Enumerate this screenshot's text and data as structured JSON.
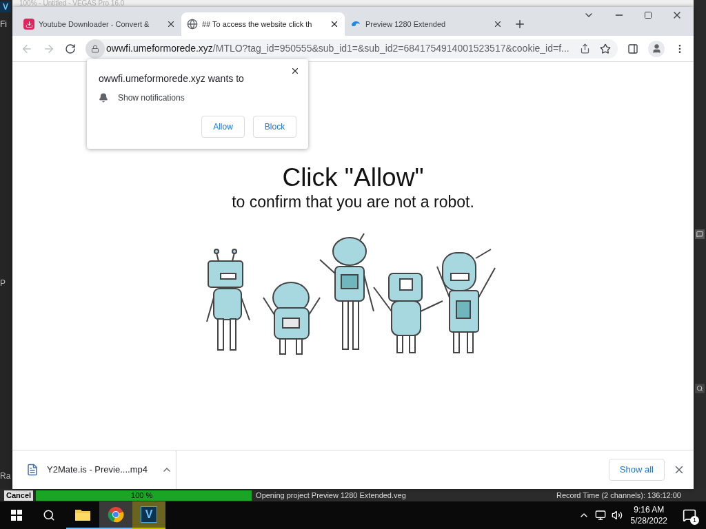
{
  "background_app": {
    "logo_letter": "V",
    "title": "100% - Untitled - VEGAS Pro 16.0",
    "menu_fragment": "Fi",
    "panel_fragment_1": "P",
    "panel_fragment_2": "Ra"
  },
  "browser": {
    "tabs": [
      {
        "title": "Youtube Downloader - Convert &",
        "kind": "download",
        "selected": false
      },
      {
        "title": "## To access the website click th",
        "kind": "globe",
        "selected": true
      },
      {
        "title": "Preview 1280 Extended",
        "kind": "swirl",
        "selected": false
      }
    ],
    "address": {
      "host": "owwfi.umeformorede.xyz",
      "path": "/MTLO?tag_id=950555&sub_id1=&sub_id2=6841754914001523517&cookie_id=f..."
    }
  },
  "page": {
    "heading": "Click \"Allow\"",
    "subheading": "to confirm that you are not a robot."
  },
  "permission_popup": {
    "title": "owwfi.umeformorede.xyz wants to",
    "permission": "Show notifications",
    "buttons": [
      "Allow",
      "Block"
    ]
  },
  "download_bar": {
    "file": "Y2Mate.is - Previe....mp4",
    "show_all": "Show all"
  },
  "status_bar": {
    "cancel": "Cancel",
    "progress": {
      "level": 1,
      "label": "100 %"
    },
    "message": "Opening project Preview 1280 Extended.veg",
    "record_time": "Record Time (2 channels): 136:12:00"
  },
  "taskbar": {
    "apps": [
      {
        "kind": "folder",
        "selected": false,
        "flashing": false
      },
      {
        "kind": "chrome",
        "selected": true,
        "flashing": false
      },
      {
        "kind": "vegas",
        "selected": false,
        "flashing": true,
        "letter": "V"
      }
    ],
    "time": "9:16 AM",
    "date": "5/28/2022",
    "notifications": "1"
  }
}
